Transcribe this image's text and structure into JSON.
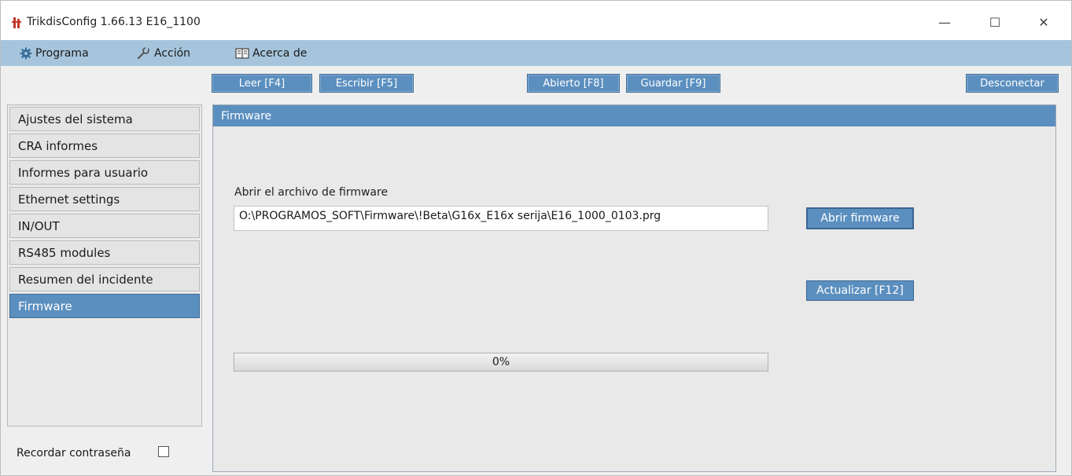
{
  "window": {
    "title": "TrikdisConfig 1.66.13   E16_1100",
    "minimize_glyph": "—",
    "maximize_glyph": "☐",
    "close_glyph": "✕"
  },
  "menu": {
    "programa": "Programa",
    "accion": "Acción",
    "acerca": "Acerca de"
  },
  "toolbar": {
    "leer": "Leer [F4]",
    "escribir": "Escribir [F5]",
    "abierto": "Abierto [F8]",
    "guardar": "Guardar [F9]",
    "desconectar": "Desconectar"
  },
  "sidebar": {
    "items": [
      {
        "label": "Ajustes del sistema",
        "active": false
      },
      {
        "label": "CRA informes",
        "active": false
      },
      {
        "label": "Informes para usuario",
        "active": false
      },
      {
        "label": "Ethernet settings",
        "active": false
      },
      {
        "label": "IN/OUT",
        "active": false
      },
      {
        "label": "RS485 modules",
        "active": false
      },
      {
        "label": "Resumen del incidente",
        "active": false
      },
      {
        "label": "Firmware",
        "active": true
      }
    ],
    "remember_password": "Recordar contraseña",
    "remember_checked": false
  },
  "panel": {
    "title": "Firmware",
    "file_label": "Abrir el archivo de firmware",
    "file_path": "O:\\PROGRAMOS_SOFT\\Firmware\\!Beta\\G16x_E16x serija\\E16_1000_0103.prg",
    "open_button": "Abrir firmware",
    "update_button": "Actualizar [F12]",
    "progress_value": 0,
    "progress_text": "0%"
  },
  "colors": {
    "accent": "#5b8fbf",
    "menubar": "#a6c5dc",
    "background": "#efefef"
  },
  "icons": {
    "app": "trikdis-logo-icon",
    "programa": "gear-icon",
    "accion": "wrench-icon",
    "acerca": "book-icon"
  }
}
